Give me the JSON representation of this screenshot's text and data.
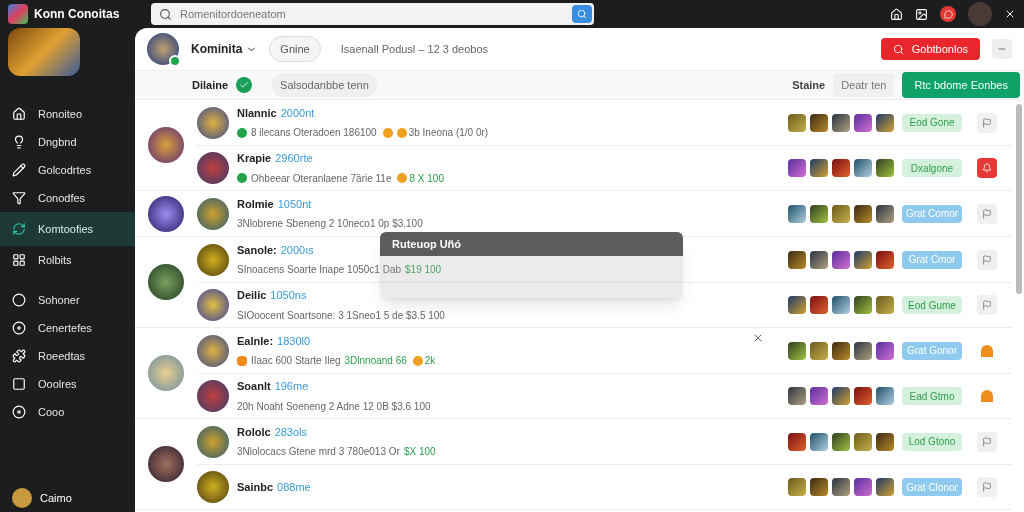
{
  "app": {
    "title": "Konn Conoitas"
  },
  "sidebar": {
    "items": [
      {
        "label": "Ronoiteo",
        "selected": false
      },
      {
        "label": "Dngbnd",
        "selected": false
      },
      {
        "label": "Golcodrtes",
        "selected": false
      },
      {
        "label": "Conodfes",
        "selected": false
      },
      {
        "label": "Komtoofies",
        "selected": true
      },
      {
        "label": "Rolbits",
        "selected": false
      },
      {
        "label": "Sohoner",
        "selected": false
      },
      {
        "label": "Cenertefes",
        "selected": false
      },
      {
        "label": "Roeedtas",
        "selected": false
      },
      {
        "label": "Ooolres",
        "selected": false
      },
      {
        "label": "Cooo",
        "selected": false
      }
    ],
    "footer": {
      "label": "Caimo"
    }
  },
  "search": {
    "placeholder": "Romenitordoeneatom"
  },
  "profile": {
    "name": "Kominita",
    "status": "Gnine",
    "info": "Isaenall Podusl – 12 3 deobos",
    "action": "Gobtbonlos"
  },
  "filter": {
    "label": "Dilaine",
    "verified": true,
    "chip": "Salsodanbbe tenn",
    "sort_label": "Staine",
    "sort_value": "Deatr ten",
    "cta": "Rtc bdome Eonbes"
  },
  "groups": [
    {
      "rows": [
        {
          "name": "Nlannic",
          "tag": "2000nt",
          "segments": [
            {
              "kind": "dot-green"
            },
            {
              "kind": "text",
              "text": "8 ilecans Oteradoen 186100"
            },
            {
              "kind": "coin"
            },
            {
              "kind": "coin"
            },
            {
              "kind": "text",
              "text": "3b Ineona (1/0 0r)"
            }
          ],
          "status": {
            "kind": "success",
            "label": "Eod Gone"
          },
          "action": {
            "kind": "neutral"
          }
        },
        {
          "name": "Krapie",
          "tag": "2960rte",
          "segments": [
            {
              "kind": "dot-green"
            },
            {
              "kind": "text",
              "text": "Ohbeear Oteranlaene 7ärie 11e"
            },
            {
              "kind": "coin"
            },
            {
              "kind": "accent",
              "text": "8 X 100"
            }
          ],
          "status": {
            "kind": "success",
            "label": "Dxalgone"
          },
          "action": {
            "kind": "alert"
          }
        }
      ]
    },
    {
      "rows": [
        {
          "name": "Rolmie",
          "tag": "1050nt",
          "segments": [
            {
              "kind": "text",
              "text": "3Nlobrene Sbeneng 2 10neco1 0p $3.100"
            }
          ],
          "status": {
            "kind": "info",
            "label": "Grat Comor"
          },
          "action": {
            "kind": "neutral"
          }
        }
      ]
    },
    {
      "rows": [
        {
          "name": "Sanole:",
          "tag": "2000ıs",
          "segments": [
            {
              "kind": "text",
              "text": "SInoacens Soarte Inape 1050c1 Dab"
            },
            {
              "kind": "accent",
              "text": "$19 100"
            }
          ],
          "status": {
            "kind": "info",
            "label": "Grat Cmor"
          },
          "action": {
            "kind": "neutral"
          }
        },
        {
          "name": "Deilic",
          "tag": "1050ns",
          "segments": [
            {
              "kind": "text",
              "text": "SIOoocent Soartsone: 3 1Sneo1 5 de $3.5 100"
            }
          ],
          "status": {
            "kind": "success",
            "label": "Eod Gume"
          },
          "action": {
            "kind": "neutral"
          }
        }
      ]
    },
    {
      "rows": [
        {
          "name": "Ealnle:",
          "tag": "1830l0",
          "segments": [
            {
              "kind": "dot-orange"
            },
            {
              "kind": "text",
              "text": "IIaac 600 Starte Ileg"
            },
            {
              "kind": "accent",
              "text": "3Dlnnoand 66"
            },
            {
              "kind": "coin"
            },
            {
              "kind": "accent",
              "text": "2k"
            }
          ],
          "status": {
            "kind": "info",
            "label": "Grat Gonor"
          },
          "action": {
            "kind": "warning"
          }
        },
        {
          "name": "Soanlt",
          "tag": "196me",
          "segments": [
            {
              "kind": "text",
              "text": "20h Noaht Soeneng 2 Adne 12 0B $3.6 100"
            }
          ],
          "status": {
            "kind": "success",
            "label": "Ead Gtmo"
          },
          "action": {
            "kind": "warning"
          }
        }
      ]
    },
    {
      "rows": [
        {
          "name": "Rololc",
          "tag": "283ols",
          "segments": [
            {
              "kind": "text",
              "text": "3Nlolocacs Gtene mrd 3 780e013 Or"
            },
            {
              "kind": "accent",
              "text": "$X 100"
            }
          ],
          "status": {
            "kind": "success",
            "label": "Lod Gtono"
          },
          "action": {
            "kind": "neutral"
          }
        },
        {
          "name": "Sainbc",
          "tag": "088me",
          "segments": [],
          "status": {
            "kind": "info",
            "label": "Grat Clonor"
          },
          "action": {
            "kind": "neutral"
          }
        }
      ]
    }
  ],
  "popup": {
    "title": "Ruteuop Uñó"
  }
}
